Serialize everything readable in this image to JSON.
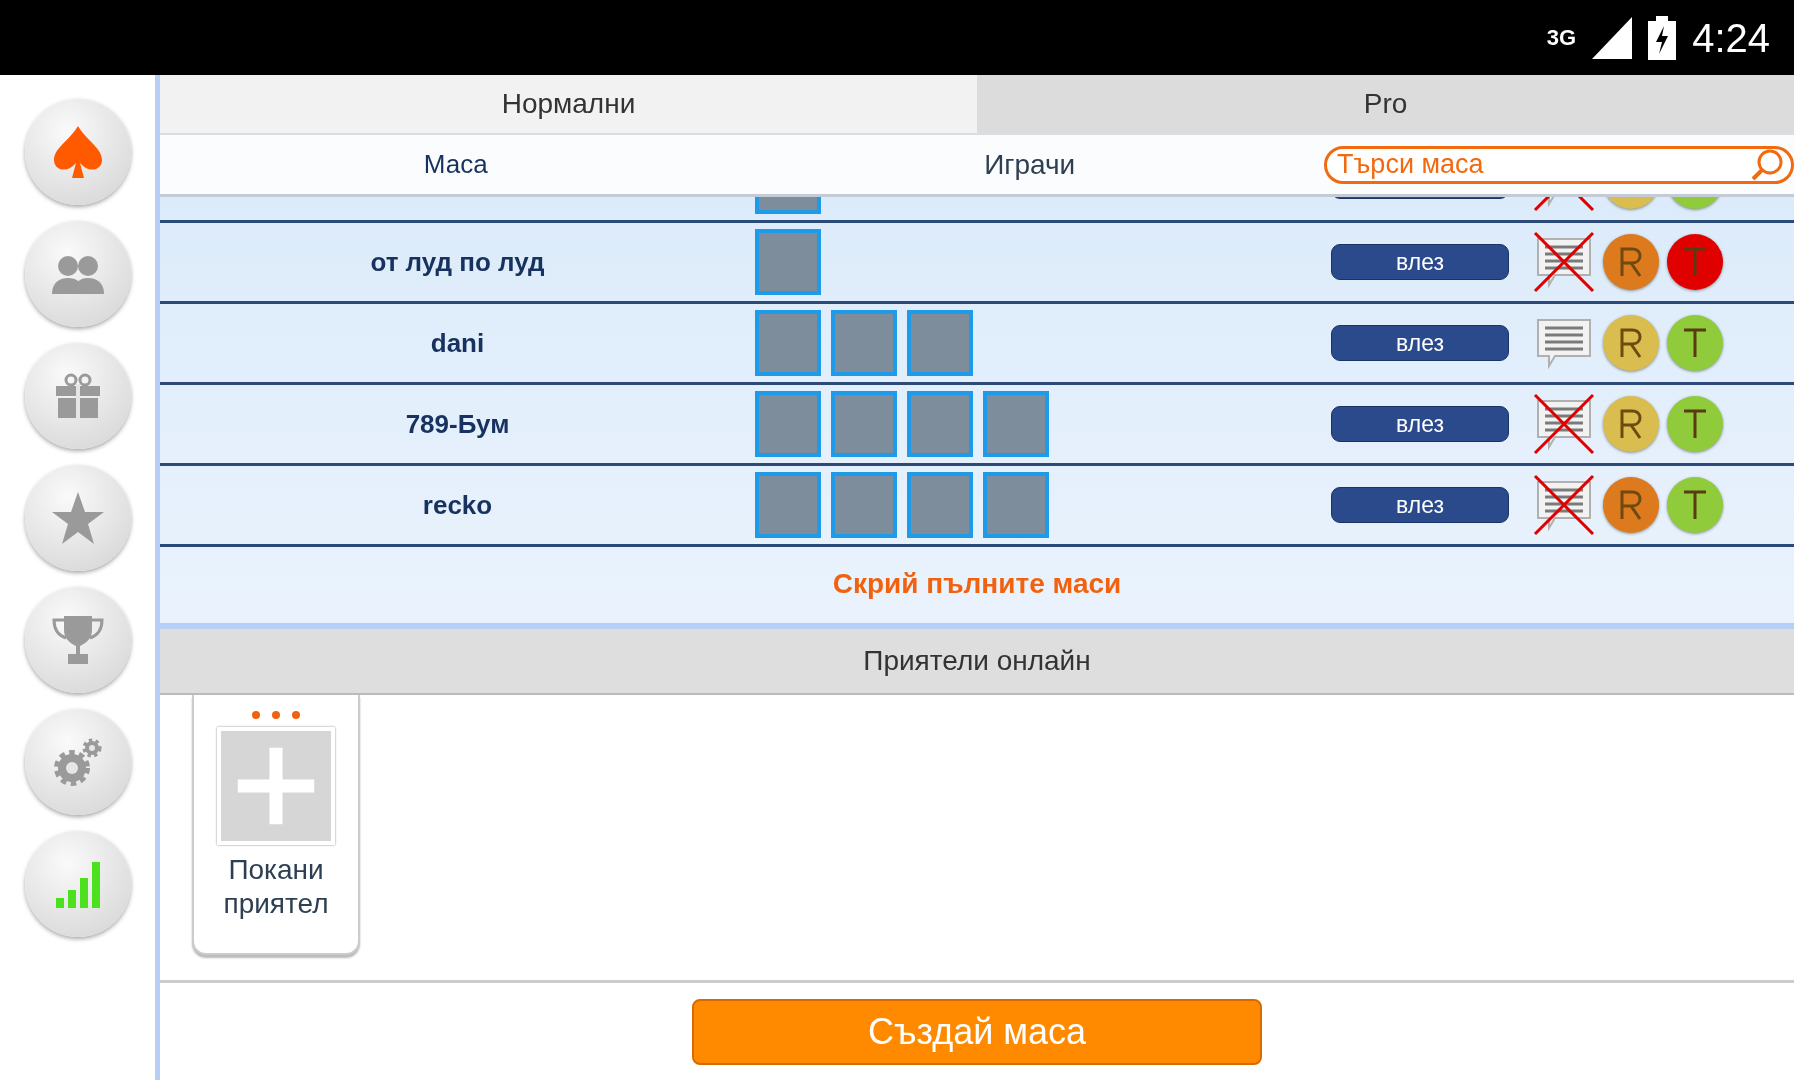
{
  "status_bar": {
    "network": "3G",
    "time": "4:24"
  },
  "sidebar": {
    "items": [
      {
        "kind": "spade",
        "selected": true
      },
      {
        "kind": "people",
        "selected": false
      },
      {
        "kind": "gift",
        "selected": false
      },
      {
        "kind": "star",
        "selected": false
      },
      {
        "kind": "trophy",
        "selected": false
      },
      {
        "kind": "gears",
        "selected": false
      },
      {
        "kind": "stats",
        "selected": false
      }
    ]
  },
  "tabs": [
    {
      "label": "Нормални",
      "selected": true
    },
    {
      "label": "Pro",
      "selected": false
    }
  ],
  "table": {
    "columns": [
      "Маса",
      "Играчи"
    ],
    "search": {
      "placeholder": "Търси маса"
    },
    "rows": [
      {
        "players": [
          {
            "kind": "photo"
          }
        ],
        "chat_disabled": true,
        "r_badge": {
          "color": "#d9bd4f"
        },
        "t_badge": {
          "color": "#8fcb3a"
        }
      },
      {
        "name": "от луд по луд",
        "players": [
          {
            "kind": "photo"
          }
        ],
        "enter_label": "влез",
        "chat_disabled": true,
        "r_badge": {
          "color": "#dd7a1e"
        },
        "t_badge": {
          "color": "#e00000"
        }
      },
      {
        "name": "dani",
        "players": [
          {
            "kind": "photo"
          },
          {
            "kind": "photo"
          },
          {
            "kind": "photo"
          }
        ],
        "enter_label": "влез",
        "chat_disabled": false,
        "r_badge": {
          "color": "#d9bd4f"
        },
        "t_badge": {
          "color": "#8fcb3a"
        }
      },
      {
        "name": "789-Бум",
        "players": [
          {
            "kind": "photo"
          },
          {
            "kind": "photo"
          },
          {
            "kind": "photo"
          },
          {
            "kind": "photo"
          }
        ],
        "enter_label": "влез",
        "chat_disabled": true,
        "r_badge": {
          "color": "#d9bd4f"
        },
        "t_badge": {
          "color": "#8fcb3a"
        }
      },
      {
        "name": "recko",
        "players": [
          {
            "kind": "photo"
          },
          {
            "kind": "photo"
          },
          {
            "kind": "photo"
          },
          {
            "kind": "photo"
          }
        ],
        "enter_label": "влез",
        "chat_disabled": true,
        "r_badge": {
          "color": "#dd7a1e"
        },
        "t_badge": {
          "color": "#8fcb3a"
        }
      }
    ],
    "hide_full_link": "Скрий пълните маси"
  },
  "friends": {
    "title": "Приятели онлайн",
    "invite_label": "Покани приятел"
  },
  "create_button": "Създай маса"
}
